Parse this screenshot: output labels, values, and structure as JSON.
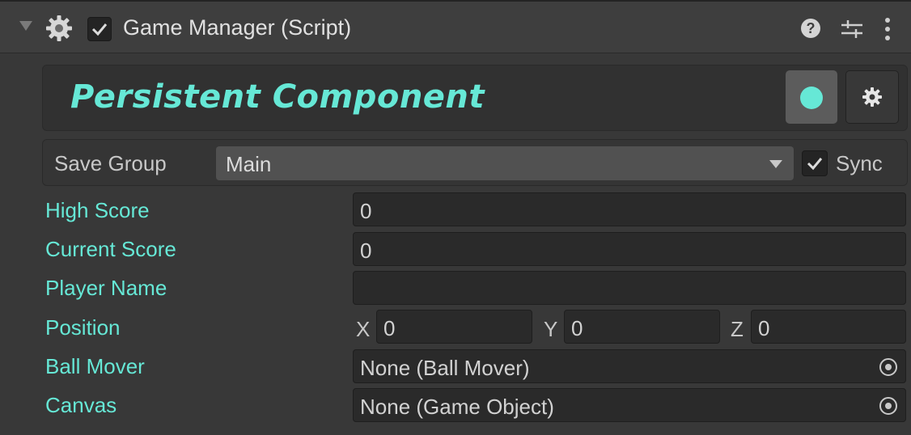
{
  "component": {
    "title": "Game Manager (Script)",
    "enabled": true,
    "icons": [
      "foldout-arrow",
      "gear-icon",
      "help-icon",
      "presets-icon",
      "kebab-menu-icon"
    ]
  },
  "banner": {
    "title": "Persistent Component",
    "accent_color": "#66e8d6",
    "dot_button_icon": "dot-icon",
    "settings_button_icon": "gear-icon"
  },
  "save_group": {
    "label": "Save Group",
    "value": "Main",
    "sync_label": "Sync",
    "sync_checked": true
  },
  "fields": {
    "high_score": {
      "label": "High Score",
      "value": "0"
    },
    "current_score": {
      "label": "Current Score",
      "value": "0"
    },
    "player_name": {
      "label": "Player Name",
      "value": ""
    },
    "position": {
      "label": "Position",
      "x_label": "X",
      "x": "0",
      "y_label": "Y",
      "y": "0",
      "z_label": "Z",
      "z": "0"
    },
    "ball_mover": {
      "label": "Ball Mover",
      "value": "None (Ball Mover)"
    },
    "canvas": {
      "label": "Canvas",
      "value": "None (Game Object)"
    }
  }
}
